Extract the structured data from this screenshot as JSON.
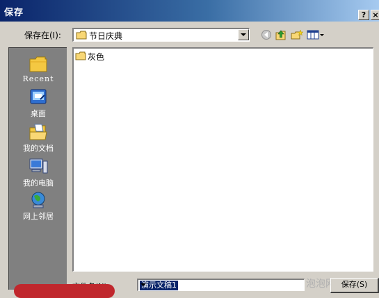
{
  "window": {
    "title": "保存",
    "help_label": "?",
    "close_label": "×"
  },
  "toolbar": {
    "save_in_label": "保存在(I):",
    "location": "节日庆典",
    "icons": [
      "back-icon",
      "up-folder-icon",
      "new-folder-icon",
      "view-menu-icon"
    ]
  },
  "places": [
    {
      "label": "Recent",
      "icon": "recent-folder-icon"
    },
    {
      "label": "桌面",
      "icon": "desktop-icon"
    },
    {
      "label": "我的文档",
      "icon": "my-documents-icon"
    },
    {
      "label": "我的电脑",
      "icon": "my-computer-icon"
    },
    {
      "label": "网上邻居",
      "icon": "network-icon"
    }
  ],
  "files": [
    {
      "name": "灰色",
      "icon": "folder-icon"
    }
  ],
  "filename": {
    "label": "文件名(N):",
    "value": "演示文稿1"
  },
  "buttons": {
    "save": "保存(S)"
  },
  "watermark": "泡泡网",
  "colors": {
    "title_start": "#0a246a",
    "title_end": "#a6caf0",
    "dialog_bg": "#d4d0c8",
    "places_bg": "#808080",
    "selection": "#0a246a"
  }
}
